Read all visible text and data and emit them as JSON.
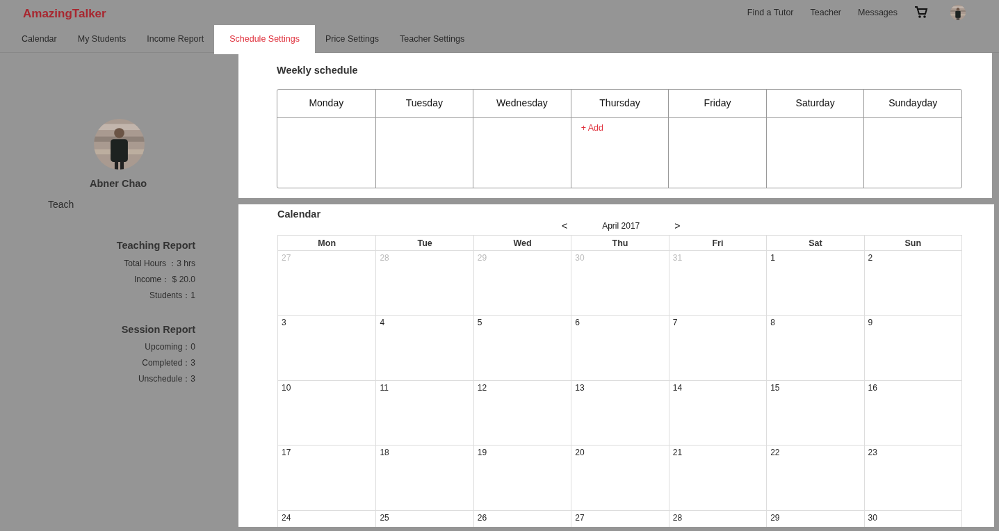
{
  "brand": "AmazingTalker",
  "top_nav": [
    "Find a Tutor",
    "Teacher",
    "Messages"
  ],
  "tabs": [
    {
      "label": "Calendar",
      "selected": false
    },
    {
      "label": "My Students",
      "selected": false
    },
    {
      "label": "Income Report",
      "selected": false
    },
    {
      "label": "Schedule Settings",
      "selected": true
    },
    {
      "label": "Price Settings",
      "selected": false
    },
    {
      "label": "Teacher Settings",
      "selected": false
    }
  ],
  "profile": {
    "name": "Abner Chao",
    "role": "Teach"
  },
  "reports": [
    {
      "title": "Teaching Report",
      "lines": [
        "Total Hours ：3 hrs",
        "Income： $ 20.0",
        "Students：1"
      ]
    },
    {
      "title": "Session Report",
      "lines": [
        "Upcoming：0",
        "Completed：3",
        "Unschedule：3"
      ]
    }
  ],
  "weekly": {
    "title": "Weekly schedule",
    "days": [
      {
        "label": "Monday"
      },
      {
        "label": "Tuesday"
      },
      {
        "label": "Wednesday"
      },
      {
        "label": "Thursday",
        "action": "+ Add"
      },
      {
        "label": "Friday"
      },
      {
        "label": "Saturday"
      },
      {
        "label": "Sundayday"
      }
    ]
  },
  "calendar": {
    "title": "Calendar",
    "prev": "<",
    "month": "April 2017",
    "next": ">",
    "columns": [
      "Mon",
      "Tue",
      "Wed",
      "Thu",
      "Fri",
      "Sat",
      "Sun"
    ],
    "weeks": [
      [
        {
          "day": "27",
          "muted": true
        },
        {
          "day": "28",
          "muted": true
        },
        {
          "day": "29",
          "muted": true
        },
        {
          "day": "30",
          "muted": true
        },
        {
          "day": "31",
          "muted": true
        },
        {
          "day": "1",
          "muted": false
        },
        {
          "day": "2",
          "muted": false
        }
      ],
      [
        {
          "day": "3",
          "muted": false
        },
        {
          "day": "4",
          "muted": false
        },
        {
          "day": "5",
          "muted": false
        },
        {
          "day": "6",
          "muted": false
        },
        {
          "day": "7",
          "muted": false
        },
        {
          "day": "8",
          "muted": false
        },
        {
          "day": "9",
          "muted": false
        }
      ],
      [
        {
          "day": "10",
          "muted": false
        },
        {
          "day": "11",
          "muted": false
        },
        {
          "day": "12",
          "muted": false
        },
        {
          "day": "13",
          "muted": false
        },
        {
          "day": "14",
          "muted": false
        },
        {
          "day": "15",
          "muted": false
        },
        {
          "day": "16",
          "muted": false
        }
      ],
      [
        {
          "day": "17",
          "muted": false
        },
        {
          "day": "18",
          "muted": false
        },
        {
          "day": "19",
          "muted": false
        },
        {
          "day": "20",
          "muted": false
        },
        {
          "day": "21",
          "muted": false
        },
        {
          "day": "22",
          "muted": false
        },
        {
          "day": "23",
          "muted": false
        }
      ],
      [
        {
          "day": "24",
          "muted": false
        },
        {
          "day": "25",
          "muted": false
        },
        {
          "day": "26",
          "muted": false
        },
        {
          "day": "27",
          "muted": false
        },
        {
          "day": "28",
          "muted": false
        },
        {
          "day": "29",
          "muted": false
        },
        {
          "day": "30",
          "muted": false
        }
      ]
    ]
  }
}
